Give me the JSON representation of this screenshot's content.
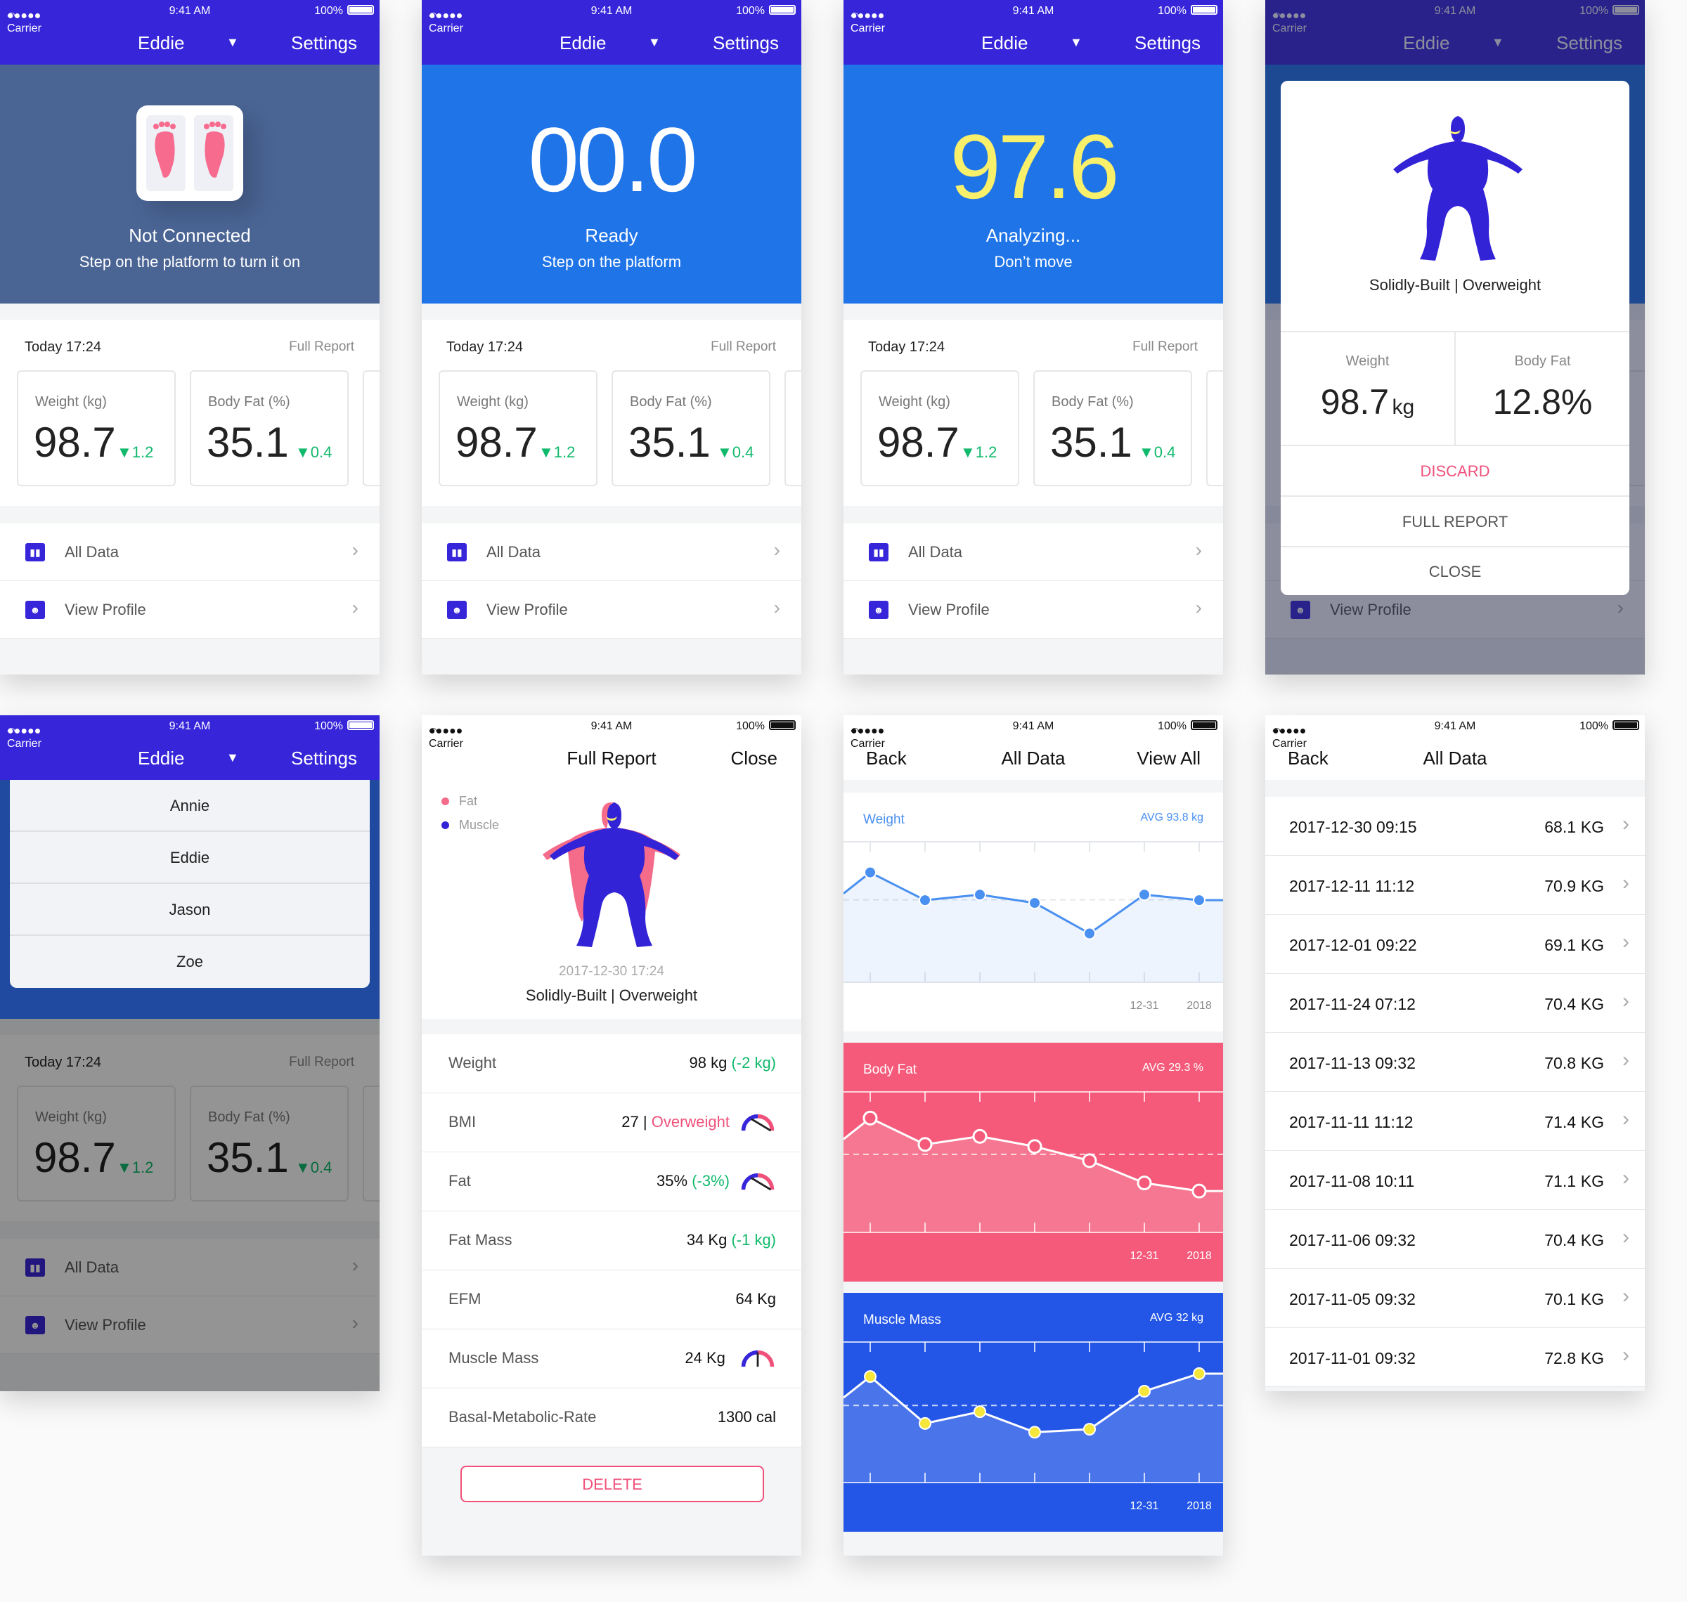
{
  "status": {
    "carrier": "●●●●● Carrier",
    "time": "9:41 AM",
    "battery": "100%"
  },
  "header": {
    "user": "Eddie",
    "arrow": "▼",
    "settings": "Settings"
  },
  "s1": {
    "title": "Not Connected",
    "sub": "Step on the platform to turn it on"
  },
  "s2": {
    "value": "00.0",
    "title": "Ready",
    "sub": "Step on the platform"
  },
  "s3": {
    "value": "97.6",
    "title": "Analyzing...",
    "sub": "Don’t move"
  },
  "summary": {
    "today": "Today 17:24",
    "full_report": "Full Report",
    "weight_label": "Weight (kg)",
    "weight": "98.7",
    "weight_delta": "▼1.2",
    "fat_label": "Body Fat (%)",
    "fat": "35.1",
    "fat_delta": "▼0.4"
  },
  "menu": {
    "all_data": "All Data",
    "view_profile": "View Profile",
    "chev": "›"
  },
  "modal": {
    "type": "Solidly-Built | Overweight",
    "weight_label": "Weight",
    "weight": "98.7",
    "weight_unit": "kg",
    "fat_label": "Body Fat",
    "fat": "12.8%",
    "discard": "DISCARD",
    "full": "FULL REPORT",
    "close": "CLOSE"
  },
  "users": [
    "Annie",
    "Eddie",
    "Jason",
    "Zoe"
  ],
  "report": {
    "title": "Full Report",
    "close": "Close",
    "legend_fat": "Fat",
    "legend_muscle": "Muscle",
    "date": "2017-12-30  17:24",
    "type": "Solidly-Built | Overweight",
    "rows": [
      {
        "label": "Weight",
        "value": "98 kg",
        "extra": "(-2 kg)",
        "cls": "green"
      },
      {
        "label": "BMI",
        "value": "27 |",
        "extra": "Overweight",
        "cls": "pink",
        "gauge": "g1"
      },
      {
        "label": "Fat",
        "value": "35%",
        "extra": "(-3%)",
        "cls": "green",
        "gauge": "g2"
      },
      {
        "label": "Fat Mass",
        "value": "34 Kg",
        "extra": "(-1 kg)",
        "cls": "green"
      },
      {
        "label": "EFM",
        "value": "64 Kg",
        "extra": "",
        "cls": ""
      },
      {
        "label": "Muscle Mass",
        "value": "24 Kg",
        "extra": "",
        "cls": "",
        "gauge": "g3"
      },
      {
        "label": "Basal-Metabolic-Rate",
        "value": "1300 cal",
        "extra": "",
        "cls": ""
      }
    ],
    "delete": "DELETE"
  },
  "alldata": {
    "back": "Back",
    "title": "All Data",
    "view_all": "View All"
  },
  "chart_data": [
    {
      "type": "line",
      "title": "Weight",
      "annotation": "AVG 93.8 kg",
      "x": [
        "",
        "",
        "",
        "",
        "",
        "",
        ""
      ],
      "tick_labels": [
        "12-31",
        "2018"
      ],
      "values": [
        94.8,
        93.8,
        94.0,
        93.7,
        92.6,
        94.0,
        93.8
      ],
      "color": "#4a90f0"
    },
    {
      "type": "line",
      "title": "Body Fat",
      "annotation": "AVG 29.3 %",
      "x": [
        "",
        "",
        "",
        "",
        "",
        "",
        ""
      ],
      "tick_labels": [
        "12-31",
        "2018"
      ],
      "values": [
        31.5,
        30.2,
        30.6,
        30.1,
        29.4,
        28.3,
        27.9
      ],
      "color": "#ffffff"
    },
    {
      "type": "line",
      "title": "Muscle Mass",
      "annotation": "AVG 32 kg",
      "x": [
        "",
        "",
        "",
        "",
        "",
        "",
        ""
      ],
      "tick_labels": [
        "12-31",
        "2018"
      ],
      "values": [
        34.0,
        32.4,
        32.8,
        32.1,
        32.2,
        33.5,
        34.1
      ],
      "color": "#f5e63b"
    }
  ],
  "records": [
    {
      "date": "2017-12-30  09:15",
      "value": "68.1",
      "unit": "KG"
    },
    {
      "date": "2017-12-11  11:12",
      "value": "70.9",
      "unit": "KG"
    },
    {
      "date": "2017-12-01  09:22",
      "value": "69.1",
      "unit": "KG"
    },
    {
      "date": "2017-11-24  07:12",
      "value": "70.4",
      "unit": "KG"
    },
    {
      "date": "2017-11-13  09:32",
      "value": "70.8",
      "unit": "KG"
    },
    {
      "date": "2017-11-11  11:12",
      "value": "71.4",
      "unit": "KG"
    },
    {
      "date": "2017-11-08  10:11",
      "value": "71.1",
      "unit": "KG"
    },
    {
      "date": "2017-11-06  09:32",
      "value": "70.4",
      "unit": "KG"
    },
    {
      "date": "2017-11-05  09:32",
      "value": "70.1",
      "unit": "KG"
    },
    {
      "date": "2017-11-01  09:32",
      "value": "72.8",
      "unit": "KG"
    }
  ],
  "colors": {
    "brand": "#3726d9",
    "hero": "#1f74e8",
    "analyzing": "#f8f06a",
    "pink": "#f0517b",
    "chart_bg2": "#f55a7a",
    "chart_bg3": "#2356e6"
  }
}
